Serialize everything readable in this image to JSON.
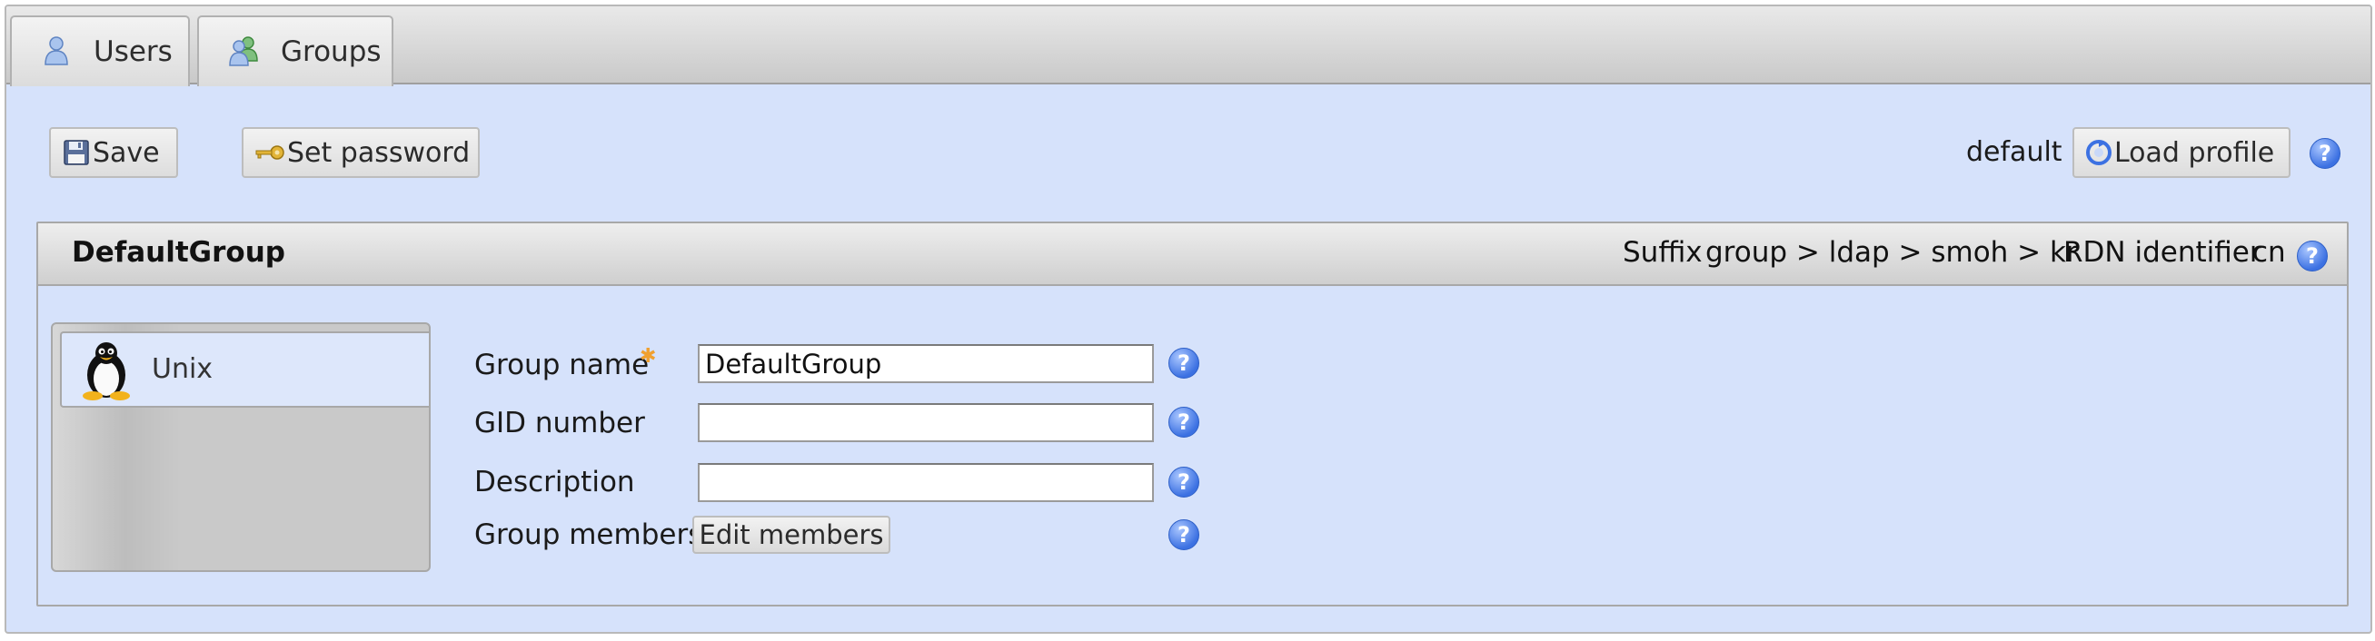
{
  "tabs": [
    {
      "label": "Users",
      "icon": "user-icon"
    },
    {
      "label": "Groups",
      "icon": "group-icon"
    }
  ],
  "toolbar": {
    "save_label": "Save",
    "save_icon": "floppy-disk-icon",
    "set_password_label": "Set password",
    "set_password_icon": "key-icon",
    "profile_value": "default",
    "load_profile_label": "Load profile",
    "load_profile_icon": "reload-icon",
    "help_icon": "help-icon"
  },
  "panel": {
    "title": "DefaultGroup",
    "suffix_label": "Suffix",
    "suffix_path": "group > ldap > smoh > kr",
    "rdn_label": "RDN identifier",
    "rdn_value": "cn"
  },
  "modules": [
    {
      "label": "Unix",
      "icon": "tux-penguin-icon"
    }
  ],
  "form": {
    "group_name": {
      "label": "Group name",
      "value": "DefaultGroup",
      "required": true
    },
    "gid_number": {
      "label": "GID number",
      "value": ""
    },
    "description": {
      "label": "Description",
      "value": ""
    },
    "group_members": {
      "label": "Group members",
      "button": "Edit members"
    },
    "help_glyph": "?"
  },
  "colors": {
    "content_bg": "#d6e2fb",
    "help_blue": "#3c71e2",
    "required_marker": "#f0a030"
  }
}
